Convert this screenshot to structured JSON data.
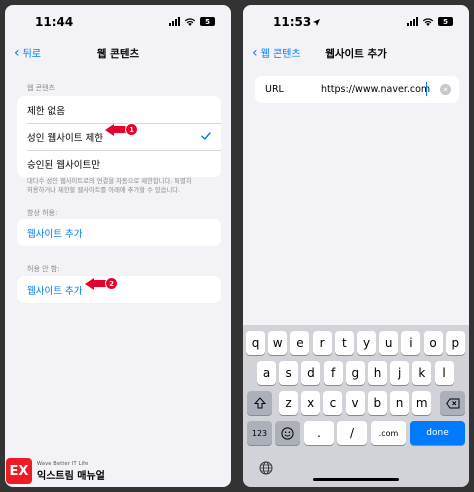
{
  "left": {
    "status": {
      "time": "11:44",
      "battery": "5"
    },
    "nav": {
      "back_label": "뒤로",
      "title": "웹 콘텐츠"
    },
    "content_section_label": "웹 콘텐츠",
    "options": [
      {
        "label": "제한 없음"
      },
      {
        "label": "성인 웹사이트 제한"
      },
      {
        "label": "승인된 웹사이트만"
      }
    ],
    "note_line1": "대다수 성인 웹사이트로의 연결을 자동으로 제한합니다. 특별히",
    "note_line2": "허용하거나 제한할 웹사이트를 아래에 추가할 수 있습니다.",
    "always_allow": {
      "label": "항상 허용:",
      "add_label": "웹사이트 추가"
    },
    "never_allow": {
      "label": "허용 안 함:",
      "add_label": "웹사이트 추가"
    },
    "callouts": [
      "1",
      "2"
    ]
  },
  "right": {
    "status": {
      "time": "11:53",
      "battery": "5"
    },
    "nav": {
      "back_label": "웹 콘텐츠",
      "title": "웹사이트 추가"
    },
    "url_field": {
      "label": "URL",
      "value": "https://www.naver.com"
    },
    "keyboard": {
      "row1": [
        "q",
        "w",
        "e",
        "r",
        "t",
        "y",
        "u",
        "i",
        "o",
        "p"
      ],
      "row2": [
        "a",
        "s",
        "d",
        "f",
        "g",
        "h",
        "j",
        "k",
        "l"
      ],
      "row3": [
        "z",
        "x",
        "c",
        "v",
        "b",
        "n",
        "m"
      ],
      "numbers_label": "123",
      "slash_label": "/",
      "dotcom_label": ".com",
      "done_label": "done"
    }
  },
  "logo": {
    "mark": "EX",
    "tagline": "Wave Better IT Life",
    "name": "익스트림 매뉴얼"
  },
  "colors": {
    "accent": "#007aff",
    "callout": "#e8002d",
    "brand": "#ee1b24"
  }
}
